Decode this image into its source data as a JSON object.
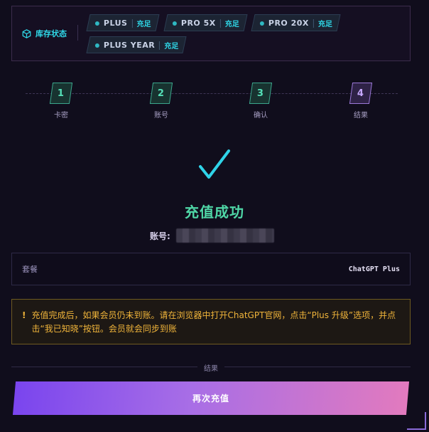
{
  "stock": {
    "label": "库存状态",
    "items": [
      {
        "name": "PLUS",
        "status": "充足"
      },
      {
        "name": "PRO 5X",
        "status": "充足"
      },
      {
        "name": "PRO 20X",
        "status": "充足"
      },
      {
        "name": "PLUS YEAR",
        "status": "充足"
      }
    ]
  },
  "steps": [
    {
      "number": "1",
      "label": "卡密"
    },
    {
      "number": "2",
      "label": "账号"
    },
    {
      "number": "3",
      "label": "确认"
    },
    {
      "number": "4",
      "label": "结果"
    }
  ],
  "result": {
    "check_glyph": "✓",
    "title": "充值成功",
    "account_label": "账号:"
  },
  "package": {
    "label": "套餐",
    "value": "ChatGPT Plus"
  },
  "notice": {
    "icon": "!",
    "text": "充值完成后，如果会员仍未到账。请在浏览器中打开ChatGPT官网，点击“Plus 升级”选项，并点击“我已知晓”按钮。会员就会同步到账"
  },
  "divider_label": "结果",
  "recharge_button": "再次充值",
  "colors": {
    "accent_cyan": "#2fd6e6",
    "success_green": "#4fd6a6",
    "warning_amber": "#f0b43a",
    "button_gradient_start": "#7a45ee",
    "button_gradient_end": "#e27abe"
  }
}
